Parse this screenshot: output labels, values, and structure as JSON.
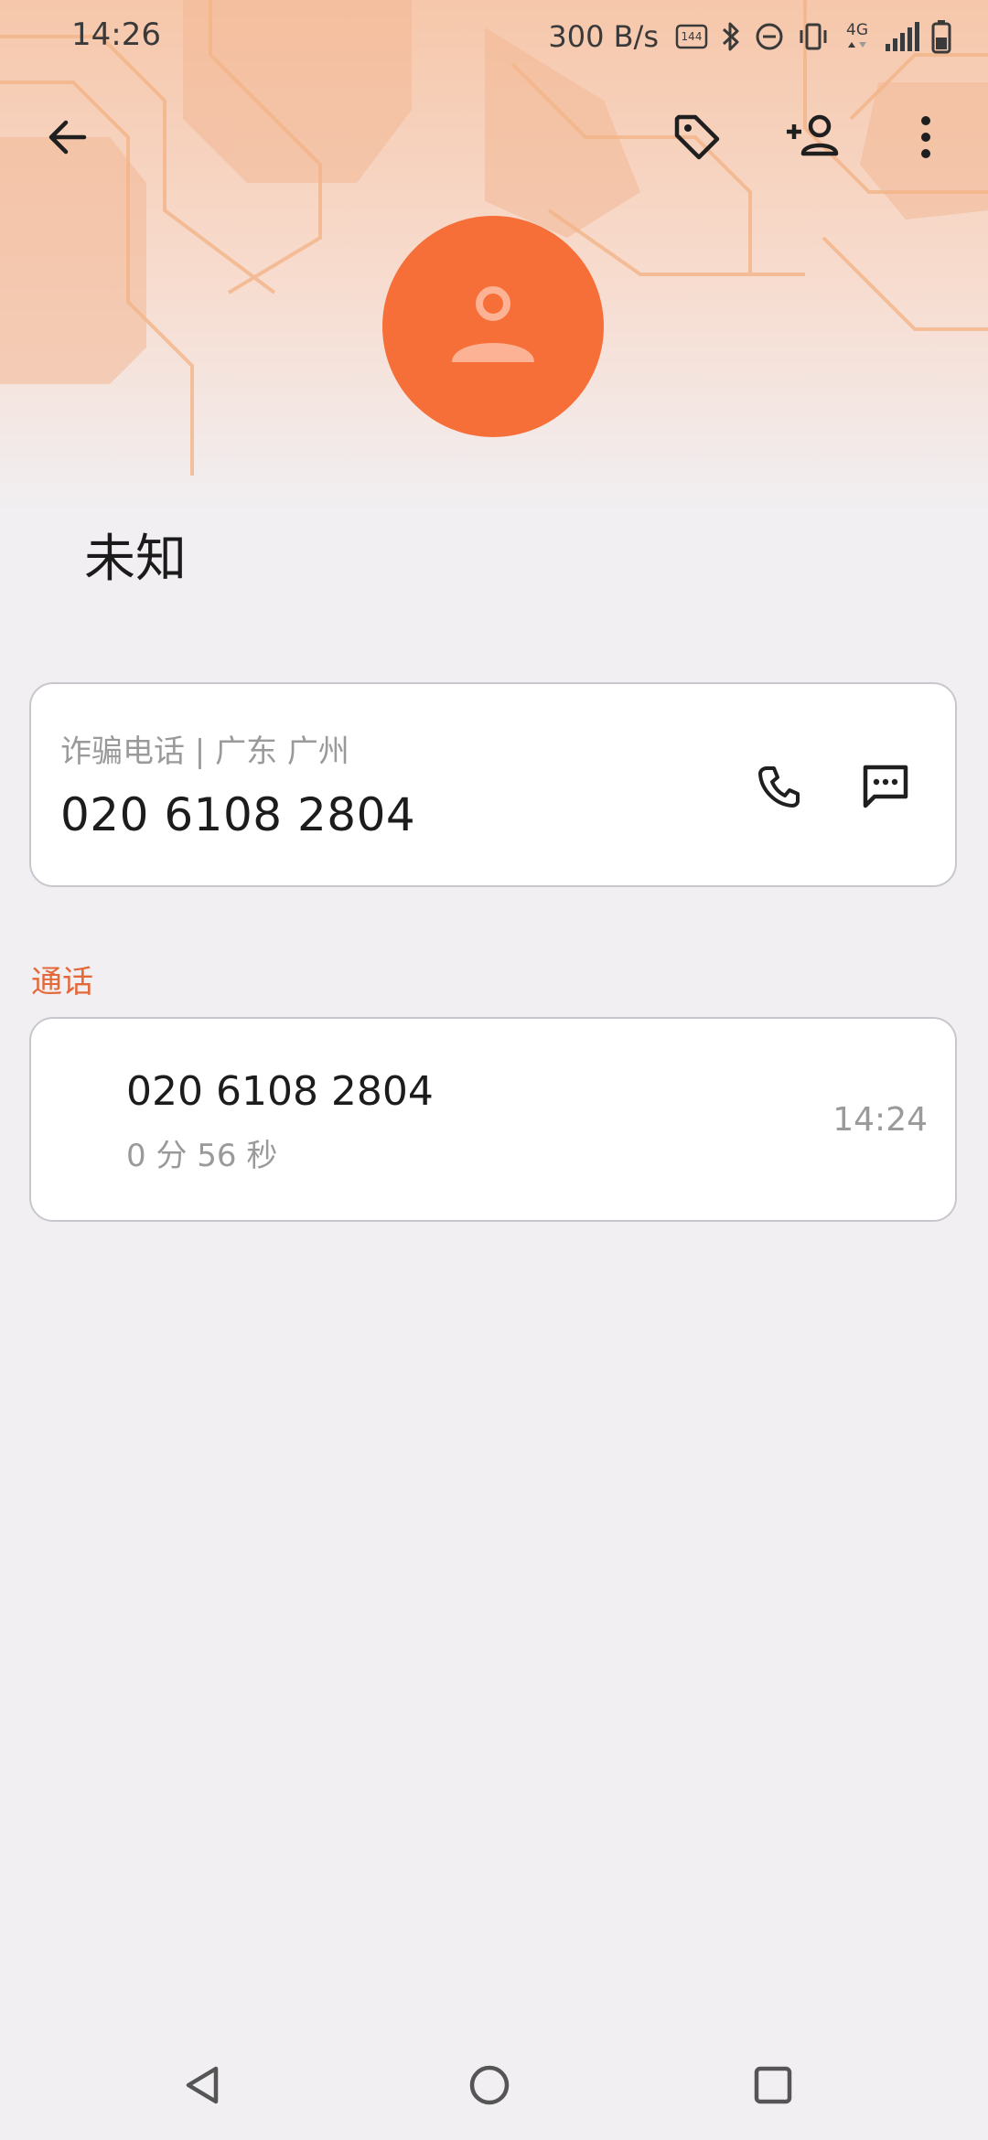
{
  "status_bar": {
    "time": "14:26",
    "net_speed": "300 B/s",
    "icons": [
      "refresh-rate-144hz-icon",
      "bluetooth-icon",
      "do-not-disturb-icon",
      "vibrate-icon",
      "4g-icon",
      "signal-icon",
      "battery-icon"
    ],
    "refresh_rate": "144",
    "network_type": "4G"
  },
  "toolbar": {
    "icons": [
      "back-arrow-icon",
      "tag-icon",
      "add-contact-icon",
      "more-vert-icon"
    ]
  },
  "contact": {
    "name": "未知",
    "tag_line": "诈骗电话 | 广东 广州",
    "number": "020 6108 2804",
    "action_icons": [
      "phone-icon",
      "message-icon"
    ]
  },
  "calls_section": {
    "label": "通话",
    "items": [
      {
        "number": "020 6108 2804",
        "duration": "0 分 56 秒",
        "time": "14:24"
      }
    ]
  },
  "nav_bar": {
    "icons": [
      "back-triangle-icon",
      "home-circle-icon",
      "recents-square-icon"
    ]
  },
  "colors": {
    "accent": "#f66f38",
    "section_label": "#e3693a",
    "background": "#f1eff2"
  }
}
